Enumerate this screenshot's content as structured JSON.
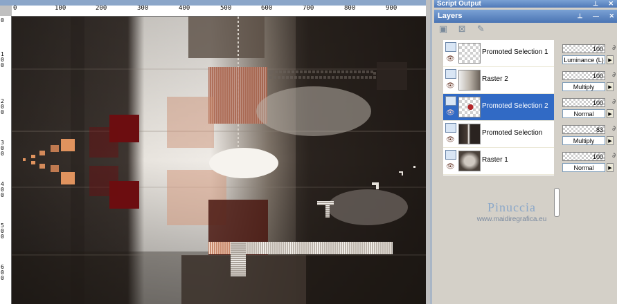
{
  "ruler": {
    "top_labels": [
      "0",
      "100",
      "200",
      "300",
      "400",
      "500",
      "600",
      "700",
      "800",
      "900"
    ],
    "left_labels": [
      "0",
      "1\n0\n0",
      "2\n0\n0",
      "3\n0\n0",
      "4\n0\n0",
      "5\n0\n0",
      "6\n0\n0"
    ]
  },
  "panels": {
    "script_output_title": "Script Output",
    "layers_title": "Layers"
  },
  "layers": [
    {
      "name": "Promoted Selection 1",
      "opacity": "100",
      "blend": "Luminance (L)",
      "selected": false,
      "thumb": "checker"
    },
    {
      "name": "Raster 2",
      "opacity": "100",
      "blend": "Multiply",
      "selected": false,
      "thumb": "raster2"
    },
    {
      "name": "Promoted Selection 2",
      "opacity": "100",
      "blend": "Normal",
      "selected": true,
      "thumb": "checker-red"
    },
    {
      "name": "Promoted Selection",
      "opacity": "83",
      "blend": "Multiply",
      "selected": false,
      "thumb": "dark"
    },
    {
      "name": "Raster 1",
      "opacity": "100",
      "blend": "Normal",
      "selected": false,
      "thumb": "raster1"
    }
  ],
  "watermark": {
    "title": "Pinuccia",
    "url": "www.maidiregrafica.eu"
  },
  "colors": {
    "title_bar": "#4f79b8",
    "selection": "#316ac5",
    "accent_red": "#7a0f12",
    "accent_orange": "#e0935e"
  }
}
